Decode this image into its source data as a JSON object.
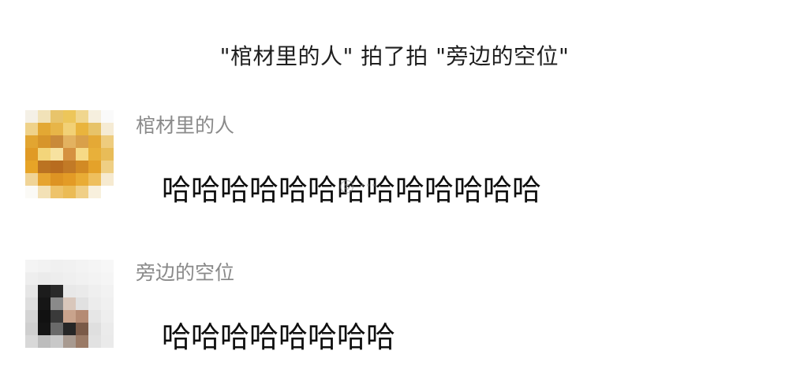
{
  "system_message": {
    "text": "\"棺材里的人\" 拍了拍 \"旁边的空位\""
  },
  "messages": [
    {
      "sender": "棺材里的人",
      "text": "哈哈哈哈哈哈哈哈哈哈哈哈哈"
    },
    {
      "sender": "旁边的空位",
      "text": "哈哈哈哈哈哈哈哈"
    }
  ],
  "colors": {
    "sender_name": "#8a8a8a",
    "message_text": "#0f0f0f",
    "avatar1_accent": "#e9a21f",
    "avatar2_accent": "#1a1a1a"
  }
}
